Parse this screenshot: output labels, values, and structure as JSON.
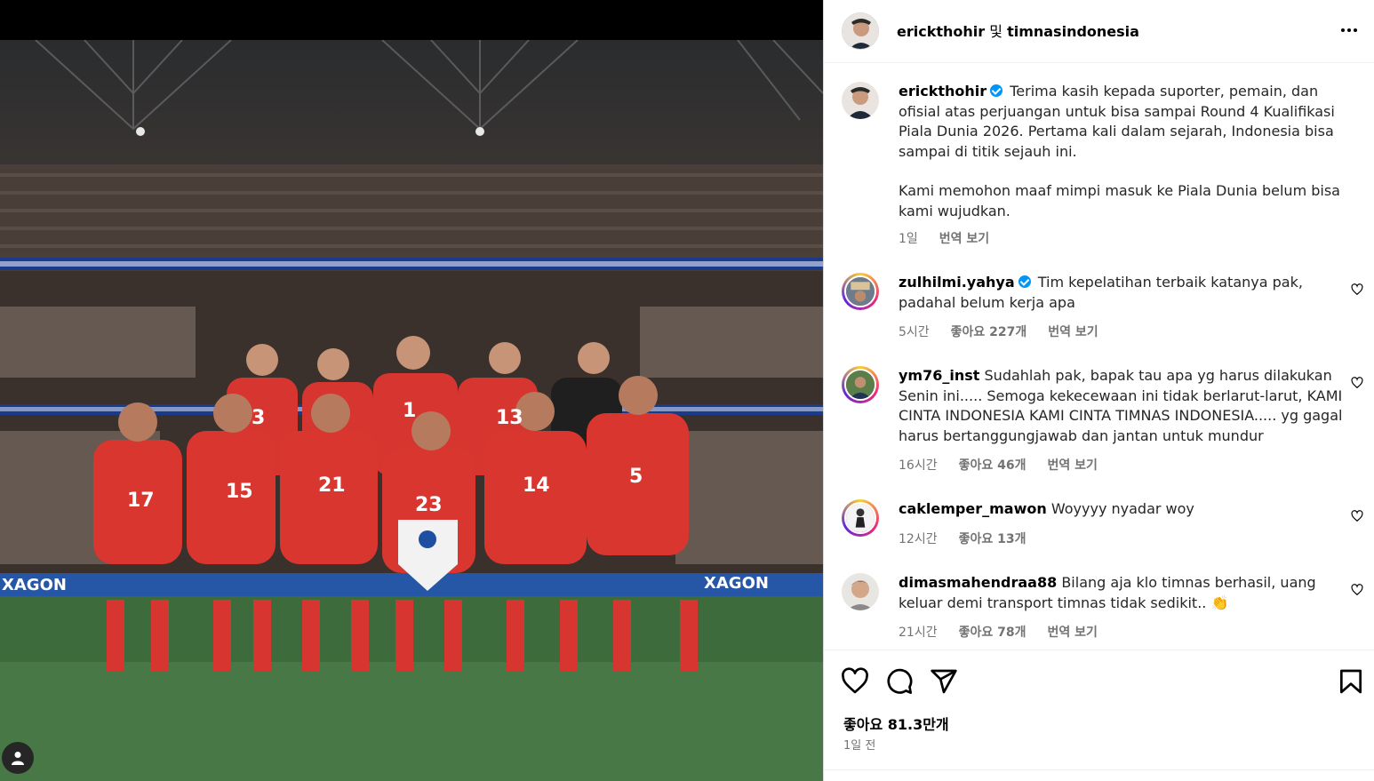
{
  "post": {
    "header_user1": "erickthohir",
    "header_sep": " 및 ",
    "header_user2": "timnasindonesia",
    "more_icon": "more-horizontal-icon"
  },
  "caption": {
    "username": "erickthohir",
    "verified": true,
    "text_p1": "Terima kasih kepada suporter, pemain, dan ofisial atas perjuangan untuk bisa sampai Round 4 Kualifikasi Piala Dunia 2026. Pertama kali dalam sejarah, Indonesia bisa sampai di titik sejauh ini.",
    "text_p2": "Kami memohon maaf mimpi masuk ke Piala Dunia belum bisa kami wujudkan.",
    "time": "1일",
    "translate": "번역 보기"
  },
  "comments": [
    {
      "username": "zulhilmi.yahya",
      "verified": true,
      "text": "Tim kepelatihan terbaik katanya pak, padahal belum kerja apa",
      "time": "5시간",
      "likes": "좋아요 227개",
      "translate": "번역 보기"
    },
    {
      "username": "ym76_inst",
      "verified": false,
      "text": "Sudahlah pak, bapak tau apa yg harus dilakukan Senin ini..... Semoga kekecewaan ini tidak berlarut-larut, KAMI CINTA INDONESIA KAMI CINTA TIMNAS INDONESIA..... yg gagal harus bertanggungjawab dan jantan untuk mundur",
      "time": "16시간",
      "likes": "좋아요 46개",
      "translate": "번역 보기"
    },
    {
      "username": "caklemper_mawon",
      "verified": false,
      "text": "Woyyyy nyadar woy",
      "time": "12시간",
      "likes": "좋아요 13개"
    },
    {
      "username": "dimasmahendraa88",
      "verified": false,
      "text": "Bilang aja klo timnas berhasil, uang keluar demi transport timnas tidak sedikit.. 👏",
      "time": "21시간",
      "likes": "좋아요 78개",
      "translate": "번역 보기"
    }
  ],
  "photo": {
    "jersey_numbers": [
      "3",
      "1",
      "13",
      "17",
      "15",
      "21",
      "23",
      "14",
      "5"
    ],
    "ad_boards": [
      "XAGON",
      "XAGON"
    ]
  },
  "actions": {
    "like_icon": "heart-icon",
    "comment_icon": "comment-icon",
    "share_icon": "share-icon",
    "save_icon": "bookmark-icon"
  },
  "likes_text": "좋아요 81.3만개",
  "posted_time": "1일 전",
  "colors": {
    "verified": "#0095f6",
    "secondary_text": "#737373",
    "jersey_red": "#d7352f"
  }
}
